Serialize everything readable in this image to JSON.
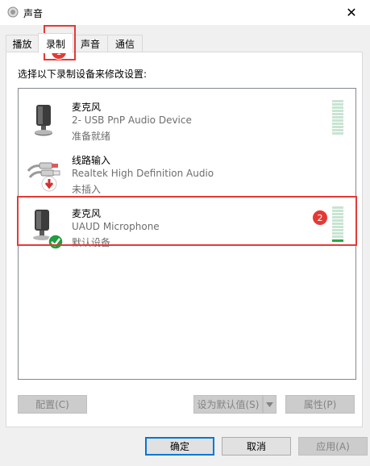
{
  "window": {
    "title": "声音",
    "close_glyph": "✕"
  },
  "tabs": [
    {
      "label": "播放",
      "active": false
    },
    {
      "label": "录制",
      "active": true
    },
    {
      "label": "声音",
      "active": false
    },
    {
      "label": "通信",
      "active": false
    }
  ],
  "instruction": "选择以下录制设备来修改设置:",
  "devices": [
    {
      "name": "麦克风",
      "description": "2- USB PnP Audio Device",
      "status": "准备就绪",
      "icon": "microphone-icon",
      "level": 0
    },
    {
      "name": "线路输入",
      "description": "Realtek High Definition Audio",
      "status": "未插入",
      "icon": "line-in-jack-icon",
      "level": 0
    },
    {
      "name": "麦克风",
      "description": "UAUD Microphone",
      "status": "默认设备",
      "icon": "microphone-icon",
      "level": 0.05,
      "default": true
    }
  ],
  "buttons": {
    "configure": "配置(C)",
    "set_default": "设为默认值(S)",
    "properties": "属性(P)",
    "ok": "确定",
    "cancel": "取消",
    "apply": "应用(A)"
  },
  "annotations": [
    "1",
    "2"
  ],
  "colors": {
    "annotation": "#e53935",
    "meter_empty": "#c9e4d3",
    "meter_active": "#27a844",
    "default_check": "#1e9e3e",
    "unplugged_arrow": "#d32f2f"
  }
}
